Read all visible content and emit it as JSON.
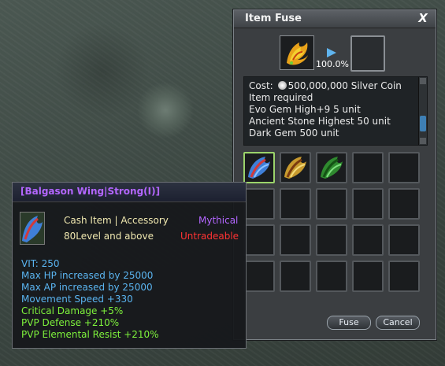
{
  "window": {
    "title": "Item Fuse",
    "close_label": "X",
    "success_rate": "100.0%",
    "cost_label": "Cost:",
    "cost_value": "500,000,000 Silver Coin",
    "requirements_heading": "Item required",
    "requirements": [
      "Evo Gem High+9 5 unit",
      "Ancient Stone Highest 50 unit",
      "Dark Gem 500 unit"
    ],
    "fuse_label": "Fuse",
    "cancel_label": "Cancel"
  },
  "tooltip": {
    "name": "[Balgason Wing|Strong(I)]",
    "type": "Cash Item | Accessory",
    "rarity": "Mythical",
    "level": "80Level and above",
    "trade": "Untradeable",
    "stats_blue": [
      "VIT: 250",
      "Max HP increased by 25000",
      "Max AP increased by 25000",
      "Movement Speed +330"
    ],
    "stats_green": [
      "Critical Damage +5%",
      "PVP Defense +210%",
      "PVP Elemental Resist +210%"
    ]
  },
  "colors": {
    "rarity": "#b366ff",
    "untradeable": "#ff3333",
    "stat_blue": "#5ab4f0",
    "stat_green": "#7ef23c"
  },
  "icons": [
    "phoenix-feather-icon",
    "blue-wing-icon",
    "gold-wing-icon",
    "green-wing-icon"
  ]
}
